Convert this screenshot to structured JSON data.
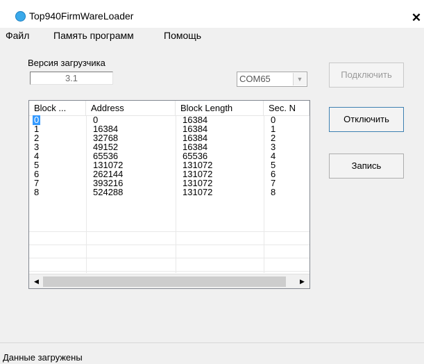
{
  "window": {
    "title": "Top940FirmWareLoader"
  },
  "menu": {
    "items": [
      "Файл",
      "Память программ",
      "Помощь"
    ]
  },
  "loader_version": {
    "label": "Версия загрузчика",
    "value": "3.1"
  },
  "port": {
    "selected": "COM65"
  },
  "buttons": {
    "connect": "Подключить",
    "disconnect": "Отключить",
    "write": "Запись"
  },
  "table": {
    "columns": [
      "Block ...",
      "Address",
      "Block Length",
      "Sec. N"
    ],
    "rows": [
      [
        "0",
        "0",
        "16384",
        "0"
      ],
      [
        "1",
        "16384",
        "16384",
        "1"
      ],
      [
        "2",
        "32768",
        "16384",
        "2"
      ],
      [
        "3",
        "49152",
        "16384",
        "3"
      ],
      [
        "4",
        "65536",
        "65536",
        "4"
      ],
      [
        "5",
        "131072",
        "131072",
        "5"
      ],
      [
        "6",
        "262144",
        "131072",
        "6"
      ],
      [
        "7",
        "393216",
        "131072",
        "7"
      ],
      [
        "8",
        "524288",
        "131072",
        "8"
      ]
    ],
    "selected_row": 0
  },
  "status": {
    "text": "Данные загружены"
  },
  "icons": {
    "app": "app-icon",
    "close": "close-icon",
    "dropdown": "chevron-down-icon",
    "scroll_left": "arrow-left-icon",
    "scroll_right": "arrow-right-icon"
  },
  "colors": {
    "selection": "#3399ff",
    "default_button_border": "#3c7fb1"
  }
}
